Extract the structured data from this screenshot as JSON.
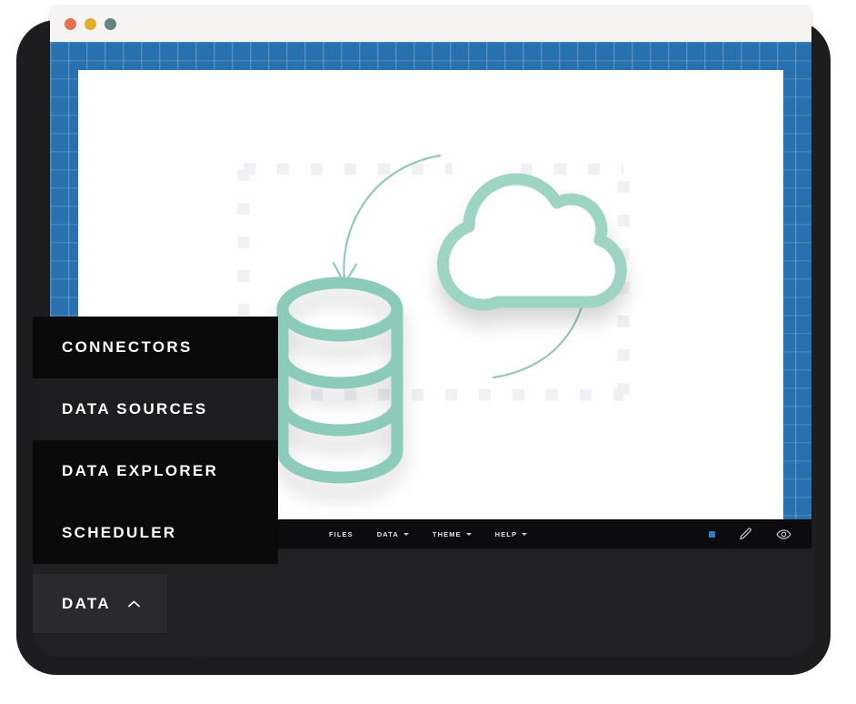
{
  "window": {
    "traffic_lights": [
      {
        "name": "close-button",
        "color": "#df7550"
      },
      {
        "name": "minimize-button",
        "color": "#ddb030"
      },
      {
        "name": "maximize-button",
        "color": "#68837f"
      }
    ],
    "canvas_background": "#ffffff",
    "grid_background": "#2871b0"
  },
  "diagram": {
    "description": "Cloud and database sync diagram",
    "accent_color": "#9ed4c4",
    "dashed_color": "#eff1f5",
    "nodes": [
      {
        "name": "cloud-icon",
        "label": "Cloud"
      },
      {
        "name": "database-icon",
        "label": "Database"
      }
    ],
    "arrows": [
      {
        "name": "arrow-cloud-to-database",
        "direction": "down"
      },
      {
        "name": "arrow-database-to-cloud",
        "direction": "up"
      }
    ]
  },
  "toolbar": {
    "items": [
      {
        "label": "FILES",
        "has_caret": false
      },
      {
        "label": "DATA",
        "has_caret": true
      },
      {
        "label": "THEME",
        "has_caret": true
      },
      {
        "label": "HELP",
        "has_caret": true
      }
    ],
    "right_icons": [
      {
        "name": "status-dot",
        "color": "#2a7ec4"
      },
      {
        "name": "pencil-icon"
      },
      {
        "name": "eye-icon"
      }
    ]
  },
  "flyout_menu": {
    "items": [
      {
        "label": "CONNECTORS",
        "active": false
      },
      {
        "label": "DATA SOURCES",
        "active": true
      },
      {
        "label": "DATA EXPLORER",
        "active": false
      },
      {
        "label": "SCHEDULER",
        "active": false
      }
    ]
  },
  "data_button": {
    "label": "DATA",
    "caret": "chevron-up"
  }
}
